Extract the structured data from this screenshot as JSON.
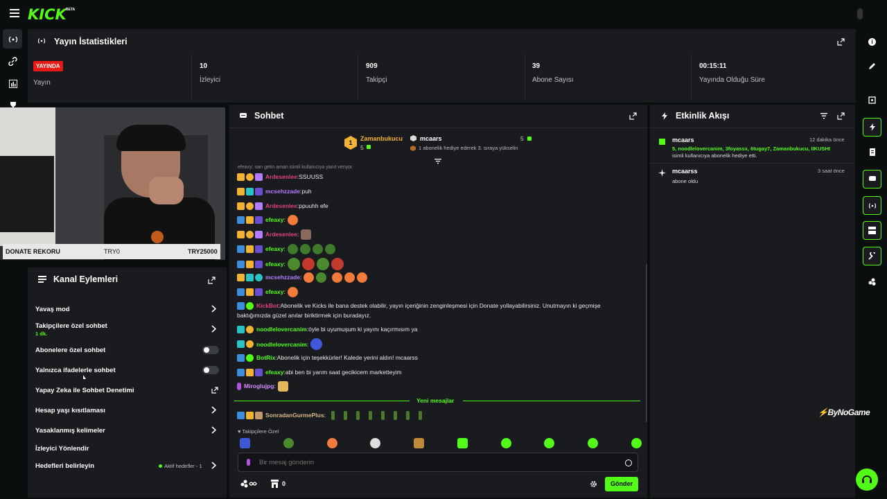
{
  "header": {
    "logo": "KICK",
    "beta": "BETA"
  },
  "stats": {
    "title": "Yayın İstatistikleri",
    "live_badge": "YAYINDA",
    "live_label": "Yayın",
    "items": [
      {
        "value": "10",
        "label": "İzleyici"
      },
      {
        "value": "909",
        "label": "Takipçi"
      },
      {
        "value": "39",
        "label": "Abone Sayısı"
      },
      {
        "value": "00:15:11",
        "label": "Yayında Olduğu Süre"
      }
    ]
  },
  "donate": {
    "label": "DONATE REKORU",
    "min": "TRY0",
    "max": "TRY25000"
  },
  "kanal": {
    "title": "Kanal Eylemleri",
    "items": [
      {
        "label": "Yavaş mod"
      },
      {
        "label": "Takipçilere özel sohbet",
        "sub": "1 dk."
      },
      {
        "label": "Abonelere özel sohbet"
      },
      {
        "label": "Yalnızca ifadelerle sohbet"
      },
      {
        "label": "Yapay Zeka ile Sohbet Denetimi"
      },
      {
        "label": "Hesap yaşı kısıtlaması"
      },
      {
        "label": "Yasaklanmış kelimeler"
      },
      {
        "label": "İzleyici Yönlendir"
      },
      {
        "label": "Hedefleri belirleyin",
        "extra": "Aktif hedefler - 1"
      }
    ]
  },
  "chat": {
    "title": "Sohbet",
    "gifter1": {
      "rank": "1",
      "name": "Zamanbukucu",
      "count": "5"
    },
    "gifter2": {
      "name": "mcaars",
      "count": "5",
      "note": "1 abonelik hediye ederek 3. sıraya yükselin"
    },
    "reply_note": "efeaxy: sarı getin aman isimli kullanıcıya yanıt veriyor",
    "messages": [
      {
        "user": "Ardesenlee",
        "text": "SSUUSS",
        "color": "#e0447a"
      },
      {
        "user": "mcsehzzade",
        "text": "puh",
        "color": "#b47cff"
      },
      {
        "user": "Ardesenlee",
        "text": "ppuuhh efe",
        "color": "#e0447a"
      },
      {
        "user": "efeaxy",
        "text": "",
        "color": "#53fc18"
      },
      {
        "user": "Ardesenlee",
        "text": "",
        "color": "#e0447a"
      },
      {
        "user": "efeaxy",
        "text": "",
        "color": "#53fc18"
      },
      {
        "user": "efeaxy",
        "text": "",
        "color": "#53fc18"
      },
      {
        "user": "mcsehzzade",
        "text": "",
        "color": "#b47cff"
      },
      {
        "user": "efeaxy",
        "text": "",
        "color": "#53fc18"
      },
      {
        "user": "KickBot",
        "text": "Abonelik ve Kicks ile bana destek olabilir, yayın içeriğinin zenginleşmesi için Donate yollayabilirsiniz. Unutmayın ki geçmişe",
        "text2": "baktığımızda güzel anılar biriktirmek için buradayız.",
        "color": "#e0447a"
      },
      {
        "user": "noodlelovercanim",
        "text": "öyle bi uyumuşum ki yayını kaçırmısım ya",
        "color": "#53fc18"
      },
      {
        "user": "noodlelovercanim",
        "text": "",
        "color": "#53fc18"
      },
      {
        "user": "BotRix",
        "text": "Abonelik için teşekkürler! Kalede yerini aldın! mcaarss",
        "color": "#53fc18"
      },
      {
        "user": "efeaxy",
        "text": "abi ben bi yarım saat gecikicem marketteyim",
        "color": "#53fc18"
      },
      {
        "user": "Miroglujpg",
        "text": "",
        "color": "#d58bff"
      }
    ],
    "new_messages": "Yeni mesajlar",
    "last_message": {
      "user": "SonradanGurmePlus",
      "text": "",
      "color": "#d8b88a"
    },
    "followers_only": "Takipçilere Özel",
    "input_placeholder": "Bir mesaj gönderin",
    "kicks_count": "0",
    "send": "Gönder"
  },
  "events": {
    "title": "Etkinlik Akışı",
    "items": [
      {
        "user": "mcaars",
        "time": "12 dakika önce",
        "line1": "5, noodlelovercanim, 3foyassx, 6tugay7, Zamanbukucu, IIKUSHI",
        "line2": "isimli kullanıcıya abonelik hediye etti."
      },
      {
        "user": "mcaarss",
        "time": "3 saat önce",
        "line1": "abone oldu"
      }
    ]
  },
  "watermark": "ByNoGame",
  "colors": {
    "accent": "#53fc18",
    "panel": "#191b1f",
    "bg": "#0b0e0f",
    "live": "#e91916"
  }
}
